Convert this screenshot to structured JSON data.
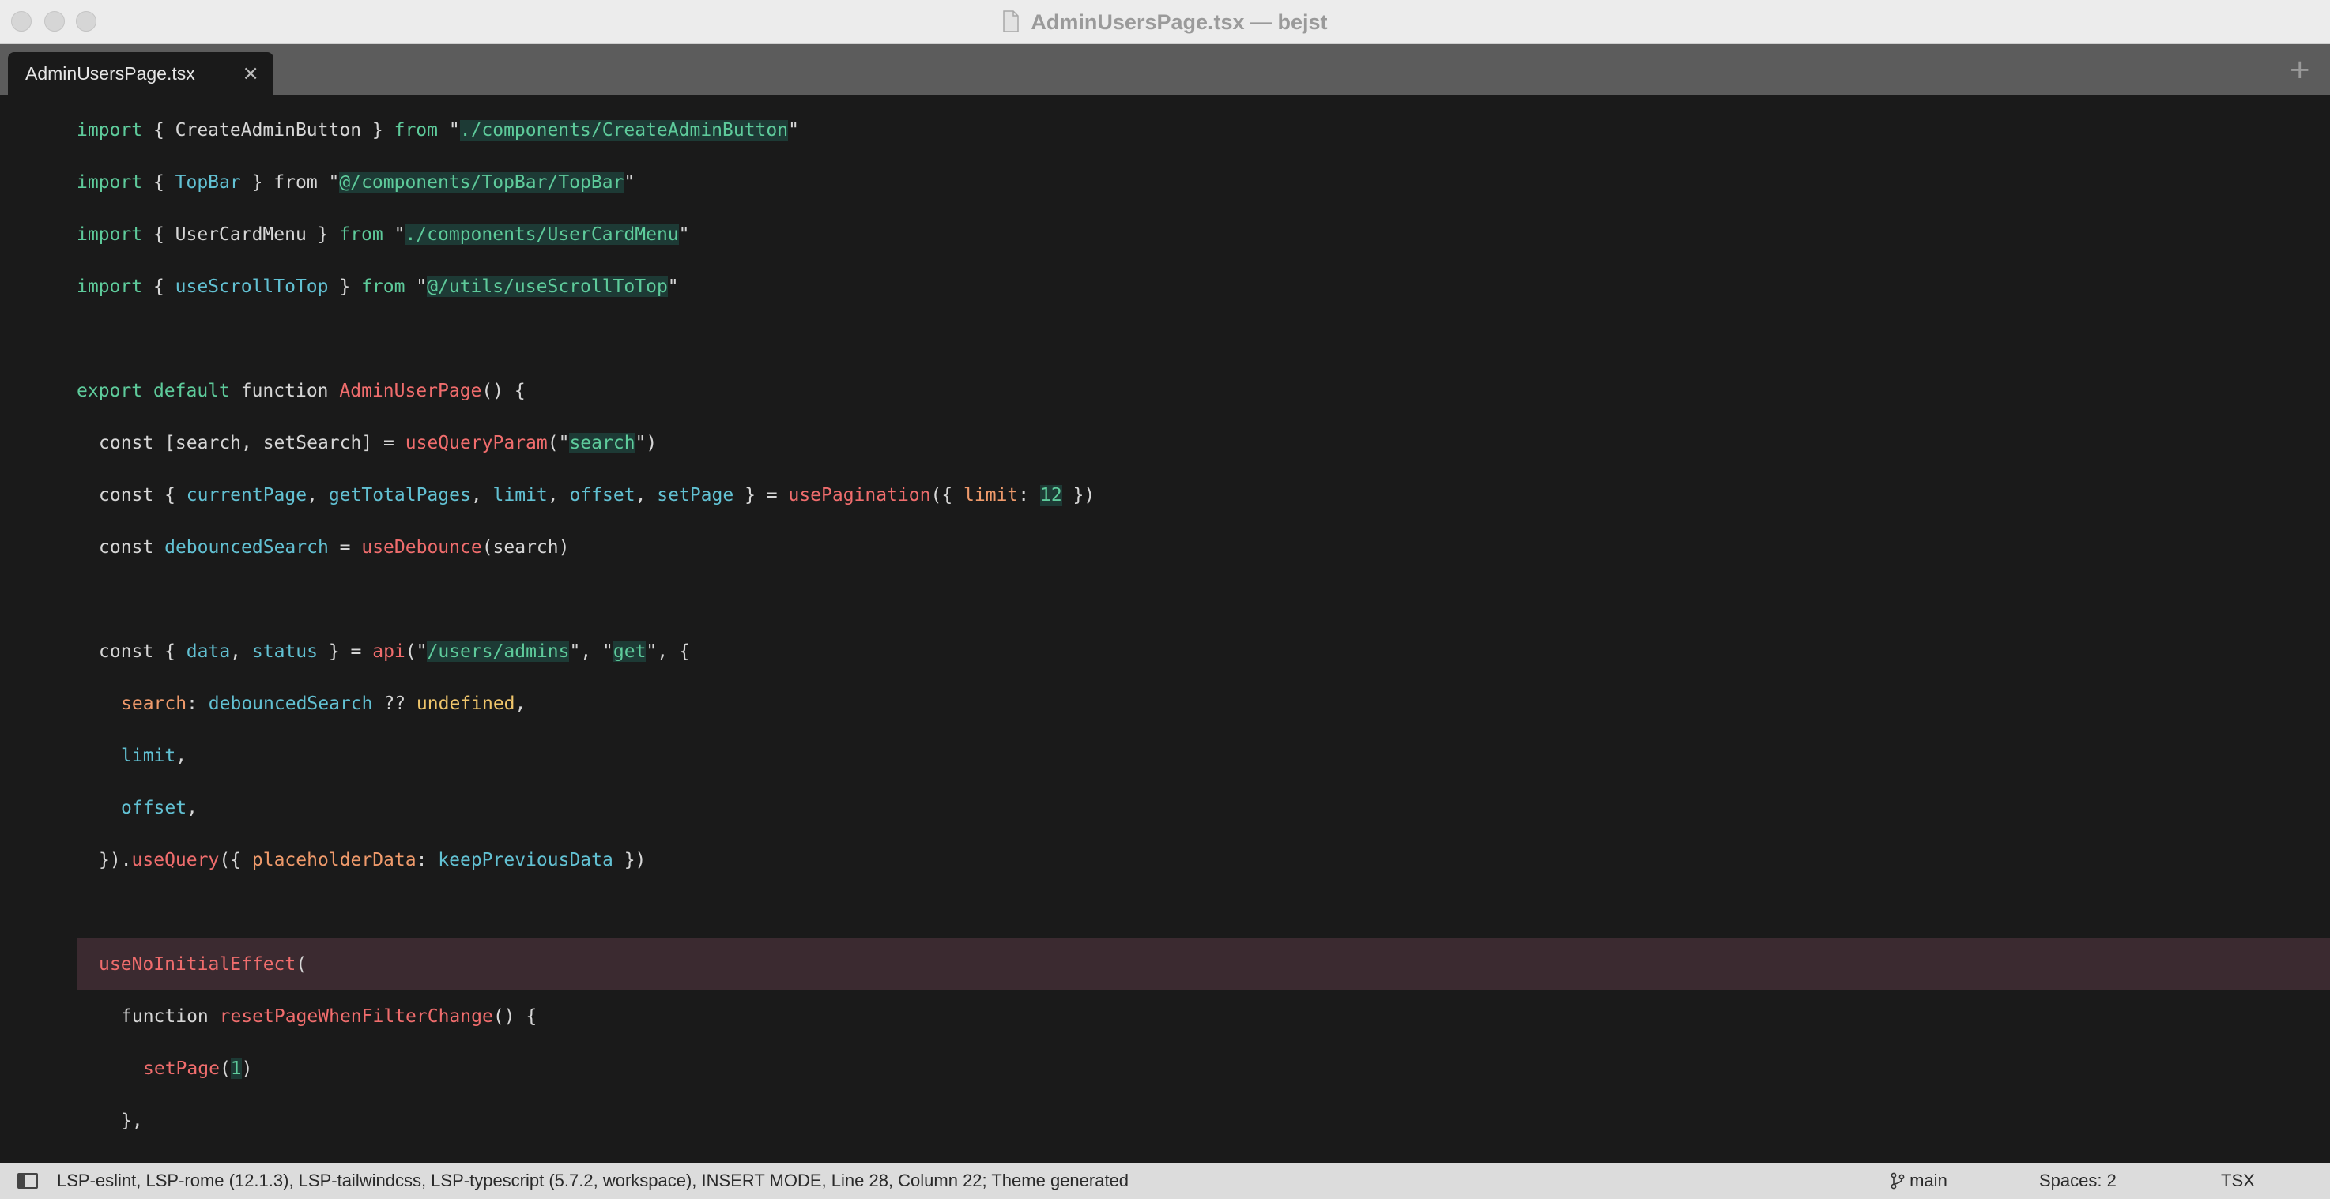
{
  "window": {
    "title": "AdminUsersPage.tsx — bejst",
    "file_icon": "document-icon"
  },
  "tabs": [
    {
      "label": "AdminUsersPage.tsx",
      "close": "×"
    }
  ],
  "tab_add": "+",
  "code_lines": [
    {
      "hl": false,
      "indent": 0,
      "tokens": [
        {
          "t": "import",
          "c": "kw"
        },
        {
          "t": " { ",
          "c": "plain"
        },
        {
          "t": "CreateAdminButton",
          "c": "plain"
        },
        {
          "t": " } ",
          "c": "plain"
        },
        {
          "t": "from",
          "c": "kw"
        },
        {
          "t": " \"",
          "c": "plain"
        },
        {
          "t": "./components/CreateAdminButton",
          "c": "str"
        },
        {
          "t": "\"",
          "c": "plain"
        }
      ]
    },
    {
      "hl": false,
      "indent": 0,
      "tokens": [
        {
          "t": "import",
          "c": "kw"
        },
        {
          "t": " { ",
          "c": "plain"
        },
        {
          "t": "TopBar",
          "c": "var"
        },
        {
          "t": " } ",
          "c": "plain"
        },
        {
          "t": "from",
          "c": "plain"
        },
        {
          "t": " \"",
          "c": "plain"
        },
        {
          "t": "@/components/TopBar/TopBar",
          "c": "str"
        },
        {
          "t": "\"",
          "c": "plain"
        }
      ]
    },
    {
      "hl": false,
      "indent": 0,
      "tokens": [
        {
          "t": "import",
          "c": "kw"
        },
        {
          "t": " { ",
          "c": "plain"
        },
        {
          "t": "UserCardMenu",
          "c": "plain"
        },
        {
          "t": " } ",
          "c": "plain"
        },
        {
          "t": "from",
          "c": "kw"
        },
        {
          "t": " \"",
          "c": "plain"
        },
        {
          "t": "./components/UserCardMenu",
          "c": "str"
        },
        {
          "t": "\"",
          "c": "plain"
        }
      ]
    },
    {
      "hl": false,
      "indent": 0,
      "tokens": [
        {
          "t": "import",
          "c": "kw"
        },
        {
          "t": " { ",
          "c": "plain"
        },
        {
          "t": "useScrollToTop",
          "c": "var"
        },
        {
          "t": " } ",
          "c": "plain"
        },
        {
          "t": "from",
          "c": "kw"
        },
        {
          "t": " \"",
          "c": "plain"
        },
        {
          "t": "@/utils/useScrollToTop",
          "c": "str"
        },
        {
          "t": "\"",
          "c": "plain"
        }
      ]
    },
    {
      "hl": false,
      "indent": 0,
      "tokens": []
    },
    {
      "hl": false,
      "indent": 0,
      "tokens": [
        {
          "t": "export",
          "c": "kw"
        },
        {
          "t": " ",
          "c": "plain"
        },
        {
          "t": "default",
          "c": "kw"
        },
        {
          "t": " function ",
          "c": "plain"
        },
        {
          "t": "AdminUserPage",
          "c": "fn"
        },
        {
          "t": "() {",
          "c": "plain"
        }
      ]
    },
    {
      "hl": false,
      "indent": 1,
      "tokens": [
        {
          "t": "const [search, setSearch] = ",
          "c": "plain"
        },
        {
          "t": "useQueryParam",
          "c": "fn"
        },
        {
          "t": "(\"",
          "c": "plain"
        },
        {
          "t": "search",
          "c": "str"
        },
        {
          "t": "\")",
          "c": "plain"
        }
      ]
    },
    {
      "hl": false,
      "indent": 1,
      "tokens": [
        {
          "t": "const { ",
          "c": "plain"
        },
        {
          "t": "currentPage",
          "c": "var"
        },
        {
          "t": ", ",
          "c": "plain"
        },
        {
          "t": "getTotalPages",
          "c": "var"
        },
        {
          "t": ", ",
          "c": "plain"
        },
        {
          "t": "limit",
          "c": "var"
        },
        {
          "t": ", ",
          "c": "plain"
        },
        {
          "t": "offset",
          "c": "var"
        },
        {
          "t": ", ",
          "c": "plain"
        },
        {
          "t": "setPage",
          "c": "var"
        },
        {
          "t": " } = ",
          "c": "plain"
        },
        {
          "t": "usePagination",
          "c": "fn"
        },
        {
          "t": "({ ",
          "c": "plain"
        },
        {
          "t": "limit",
          "c": "prop"
        },
        {
          "t": ": ",
          "c": "plain"
        },
        {
          "t": "12",
          "c": "str"
        },
        {
          "t": " })",
          "c": "plain"
        }
      ]
    },
    {
      "hl": false,
      "indent": 1,
      "tokens": [
        {
          "t": "const ",
          "c": "plain"
        },
        {
          "t": "debouncedSearch",
          "c": "var"
        },
        {
          "t": " = ",
          "c": "plain"
        },
        {
          "t": "useDebounce",
          "c": "fn"
        },
        {
          "t": "(search)",
          "c": "plain"
        }
      ]
    },
    {
      "hl": false,
      "indent": 0,
      "tokens": []
    },
    {
      "hl": false,
      "indent": 1,
      "tokens": [
        {
          "t": "const { ",
          "c": "plain"
        },
        {
          "t": "data",
          "c": "var"
        },
        {
          "t": ", ",
          "c": "plain"
        },
        {
          "t": "status",
          "c": "var"
        },
        {
          "t": " } = ",
          "c": "plain"
        },
        {
          "t": "api",
          "c": "fn"
        },
        {
          "t": "(\"",
          "c": "plain"
        },
        {
          "t": "/users/admins",
          "c": "str"
        },
        {
          "t": "\", \"",
          "c": "plain"
        },
        {
          "t": "get",
          "c": "str"
        },
        {
          "t": "\", {",
          "c": "plain"
        }
      ]
    },
    {
      "hl": false,
      "indent": 2,
      "tokens": [
        {
          "t": "search",
          "c": "prop"
        },
        {
          "t": ": ",
          "c": "plain"
        },
        {
          "t": "debouncedSearch",
          "c": "var"
        },
        {
          "t": " ?? ",
          "c": "plain"
        },
        {
          "t": "undefined",
          "c": "num"
        },
        {
          "t": ",",
          "c": "plain"
        }
      ]
    },
    {
      "hl": false,
      "indent": 2,
      "tokens": [
        {
          "t": "limit",
          "c": "var"
        },
        {
          "t": ",",
          "c": "plain"
        }
      ]
    },
    {
      "hl": false,
      "indent": 2,
      "tokens": [
        {
          "t": "offset",
          "c": "var"
        },
        {
          "t": ",",
          "c": "plain"
        }
      ]
    },
    {
      "hl": false,
      "indent": 1,
      "tokens": [
        {
          "t": "}).",
          "c": "plain"
        },
        {
          "t": "useQuery",
          "c": "fn"
        },
        {
          "t": "({ ",
          "c": "plain"
        },
        {
          "t": "placeholderData",
          "c": "prop"
        },
        {
          "t": ": ",
          "c": "plain"
        },
        {
          "t": "keepPreviousData",
          "c": "var"
        },
        {
          "t": " })",
          "c": "plain"
        }
      ]
    },
    {
      "hl": false,
      "indent": 0,
      "tokens": []
    },
    {
      "hl": true,
      "indent": 1,
      "tokens": [
        {
          "t": "useNoInitialEffect",
          "c": "fn"
        },
        {
          "t": "(",
          "c": "plain"
        }
      ]
    },
    {
      "hl": false,
      "indent": 2,
      "tokens": [
        {
          "t": "function ",
          "c": "plain"
        },
        {
          "t": "resetPageWhenFilterChange",
          "c": "fn"
        },
        {
          "t": "() {",
          "c": "plain"
        }
      ]
    },
    {
      "hl": false,
      "indent": 3,
      "tokens": [
        {
          "t": "setPage",
          "c": "fn"
        },
        {
          "t": "(",
          "c": "plain"
        },
        {
          "t": "1",
          "c": "str"
        },
        {
          "t": ")",
          "c": "plain"
        }
      ]
    },
    {
      "hl": false,
      "indent": 2,
      "tokens": [
        {
          "t": "},",
          "c": "plain"
        }
      ]
    }
  ],
  "status": {
    "text": "LSP-eslint, LSP-rome (12.1.3), LSP-tailwindcss, LSP-typescript (5.7.2, workspace), INSERT MODE, Line 28, Column 22; Theme generated",
    "branch_icon": "git-branch-icon",
    "branch": "main",
    "spaces": "Spaces: 2",
    "syntax": "TSX"
  }
}
